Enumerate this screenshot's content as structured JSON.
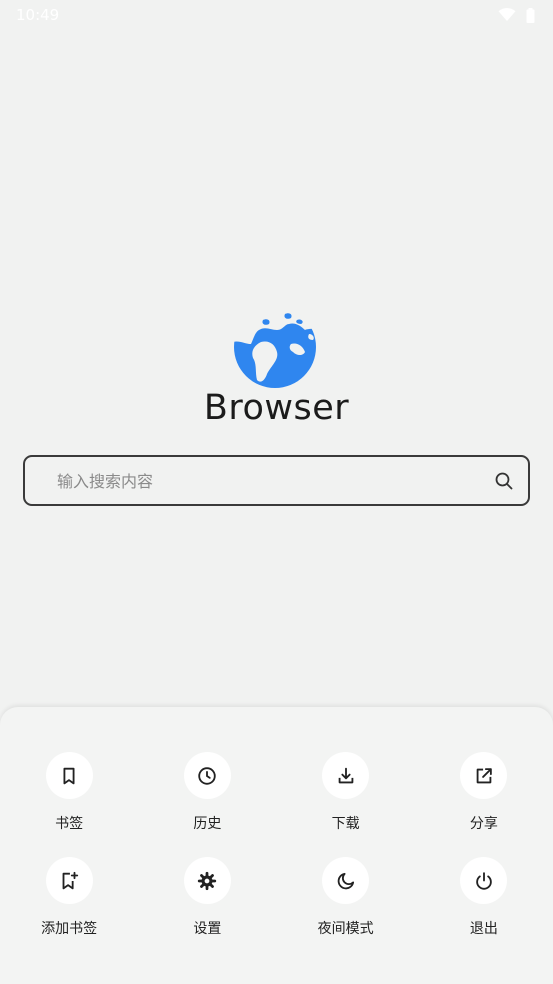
{
  "status_bar": {
    "time": "10:49"
  },
  "app": {
    "name": "Browser"
  },
  "search": {
    "placeholder": "输入搜索内容",
    "value": ""
  },
  "menu": {
    "items": [
      {
        "label": "书签",
        "icon": "bookmark-icon"
      },
      {
        "label": "历史",
        "icon": "clock-icon"
      },
      {
        "label": "下载",
        "icon": "download-icon"
      },
      {
        "label": "分享",
        "icon": "share-icon"
      },
      {
        "label": "添加书签",
        "icon": "bookmark-add-icon"
      },
      {
        "label": "设置",
        "icon": "gear-icon"
      },
      {
        "label": "夜间模式",
        "icon": "moon-icon"
      },
      {
        "label": "退出",
        "icon": "power-icon"
      }
    ]
  },
  "colors": {
    "background": "#f1f2f1",
    "logo_blue": "#2f86ef",
    "text": "#1d1d1d"
  }
}
